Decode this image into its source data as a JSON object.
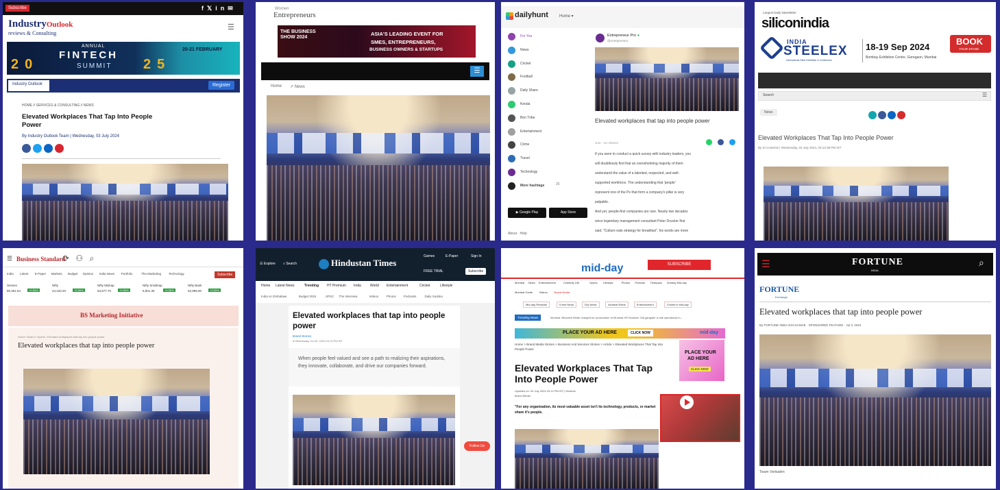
{
  "tiles": {
    "industry": {
      "subscribe": "Subscribe",
      "logo_line1": "Industry",
      "logo_line1_b": "Outlook",
      "logo_line2": "reviews & Consulting",
      "banner_annual": "ANNUAL",
      "banner_title": "FINTECH",
      "banner_summit": "SUMMIT",
      "banner_year_left": "20",
      "banner_year_right": "25",
      "banner_dates": "20-21 FEBRUARY",
      "small_logo": "Industry Outlook",
      "register_btn": "Register",
      "breadcrumb": "HOME // SERVICES & CONSULTING // NEWS",
      "headline": "Elevated Workplaces That Tap Into People Power",
      "byline": "By Industry Outlook Team | Wednesday, 03 July 2024"
    },
    "entrepreneur": {
      "logo_small": "Women",
      "logo": "Entrepreneurs",
      "banner_left": "THE BUSINESS SHOW 2024",
      "banner_right_1": "ASIA'S LEADING EVENT FOR",
      "banner_right_2": "SMES, ENTREPRENEURS,",
      "banner_right_3": "BUSINESS OWNERS & STARTUPS",
      "crumb_1": "Home",
      "crumb_2": "News"
    },
    "dailyhunt": {
      "logo": "dailyhunt",
      "menu": "Home",
      "nav": [
        "For You",
        "News",
        "Cricket",
        "Football",
        "Daily Share",
        "Kerala",
        "Bon Tribe",
        "Entertainment",
        "Crime",
        "Travel",
        "Technology",
        "More hashtags"
      ],
      "more_count": "25",
      "publisher": "Entrepreneur Pro",
      "publisher_handle": "@entrepreneur",
      "headline": "Elevated workplaces that tap into people power",
      "meta": "Just · 1m Shares",
      "body": [
        "If you were to conduct a quick survey with industry leaders, you",
        "will doubtlessly find that an overwhelming majority of them",
        "understand the value of a talented, respected, and well-",
        "supported workforce. The understanding that 'people'",
        "represent one of the Ps that form a company's pillar is very",
        "palpable.",
        "And yet, people-first companies are rare. Nearly two decades",
        "since legendary management consultant Peter Drucker first",
        "said, \"Culture eats strategy for breakfast\", his words are more"
      ],
      "gplay": "Google Play",
      "appstore": "App Store",
      "footer": "About · Help"
    },
    "siliconindia": {
      "tagline": "Largest Daily Newsletter",
      "logo": "siliconindia",
      "india": "INDIA",
      "steelex": "STEELEX",
      "steel_sub": "International Steel Exhibition & Conference",
      "dates": "18-19 Sep 2024",
      "venue": "Bombay Exhibition Centre, Goregaon, Mumbai",
      "book": "BOOK",
      "book_sub": "YOUR STAND",
      "search": "Search",
      "btn": "News",
      "headline": "Elevated Workplaces That Tap Into People Power",
      "byline": "By SI Contents | Wednesday, 03 July 2024, 03:13:38 PM IST"
    },
    "business_standard": {
      "logo": "Business Standard",
      "nav": [
        "India",
        "Latest",
        "E-Paper",
        "Markets",
        "Budget",
        "Opinion",
        "India News",
        "Portfolio",
        "The Marketing",
        "Technology"
      ],
      "subscribe": "Subscribe",
      "tickers": [
        {
          "name": "Sensex",
          "val": "80,351.64",
          "chg": "+0.55%"
        },
        {
          "name": "Nifty",
          "val": "24,433.20",
          "chg": "+0.55%"
        },
        {
          "name": "Nifty Midcap",
          "val": "53,577.70",
          "chg": "+0.55%"
        },
        {
          "name": "Nifty Smallcap",
          "val": "8,901.35",
          "chg": "+0.55%"
        },
        {
          "name": "Nifty Bank",
          "val": "52,896.90",
          "chg": "+0.55%"
        }
      ],
      "initiative": "BS Marketing Initiative",
      "crumb": "Home / Brand / Sports / Elevated workplaces that tap into people power",
      "headline": "Elevated workplaces that tap into people power"
    },
    "hindustan_times": {
      "explore": "Explore",
      "search": "Search",
      "logo": "Hindustan Times",
      "games": "Games",
      "epaper": "E-Paper",
      "signin": "Sign In",
      "free_trial": "FREE TRIAL",
      "subscribe": "Subscribe",
      "nav": [
        "Home",
        "Latest News",
        "Trending",
        "HT Premium",
        "India",
        "World",
        "Entertainment",
        "Cricket",
        "Lifestyle"
      ],
      "subnav": [
        "India vs Zimbabwe",
        "Budget 2024",
        "UPSC",
        "The Interview",
        "Videos",
        "Photos",
        "Podcasts",
        "Daily Sudoku"
      ],
      "headline": "Elevated workplaces that tap into people power",
      "byline": "Brand Stories",
      "dateline": "8 Wednesday Jul 03, 2024 03:13 PM IST",
      "lede": "When people feel valued and see a path to realizing their aspirations, they innovate, collaborate, and drive our companies forward.",
      "follow": "Follow Us"
    },
    "midday": {
      "logo": "mid-day",
      "subscribe": "SUBSCRIBE",
      "nav": [
        "Mumbai",
        "News",
        "Entertainment",
        "Celebrity Life",
        "Sports",
        "Lifestyle",
        "Photos",
        "Podcast",
        "Timepass",
        "Sunday Mid-day"
      ],
      "subnav": [
        "Mumbai Guide",
        "Videos",
        "Brand Media"
      ],
      "tabs": [
        "Mid-day Rewards",
        "Crime News",
        "City News",
        "Mumbai Rains",
        "Entertainment",
        "Cricket in Mid-day"
      ],
      "trending": "Trending News",
      "ticker": "Mumbai: Bhavesh Bhide charged for prosecution of Mumbai HR    Mumbai: Old gangster is still operational in...",
      "ad_title": "PLACE YOUR AD HERE",
      "ad_click": "CLICK NOW",
      "ad_logo": "mid-day",
      "crumb": "Home > Brand Media Stories > Business And Services Stories > Article > Elevated Workplaces That Tap Into People Power",
      "headline": "Elevated Workplaces That Tap Into People Power",
      "updated": "Updated on: 03 July 2024 03:14 PM IST | Mumbai",
      "source": "Brand Media",
      "quote": "\"For any organisation, its most valuable asset isn't its technology, products, or market share it's people.",
      "side_ad_1": "PLACE YOUR",
      "side_ad_2": "AD HERE",
      "side_ad_btn": "CLICK NOW"
    },
    "fortune": {
      "logo": "FORTUNE",
      "logo_sub": "INDIA",
      "section_logo": "FORTUNE",
      "section_sub": "Exchange",
      "headline": "Elevated workplaces that tap into people power",
      "byline": "By FORTUNE INDIA EXCHANGE · SPONSORED FEATURE · Jul 3, 2024",
      "caption": "Team Verbatim"
    }
  },
  "colors": {
    "frame": "#2a2a8c",
    "io_red": "#d6262e",
    "io_blue": "#1c2f74",
    "teal": "#13a6b0",
    "bs_red": "#c0392b",
    "ht_dark": "#12202e",
    "midday_red": "#e0262b",
    "fortune_black": "#0d0d0d",
    "si_red": "#d42c2c",
    "si_blue": "#1e3f8f"
  }
}
